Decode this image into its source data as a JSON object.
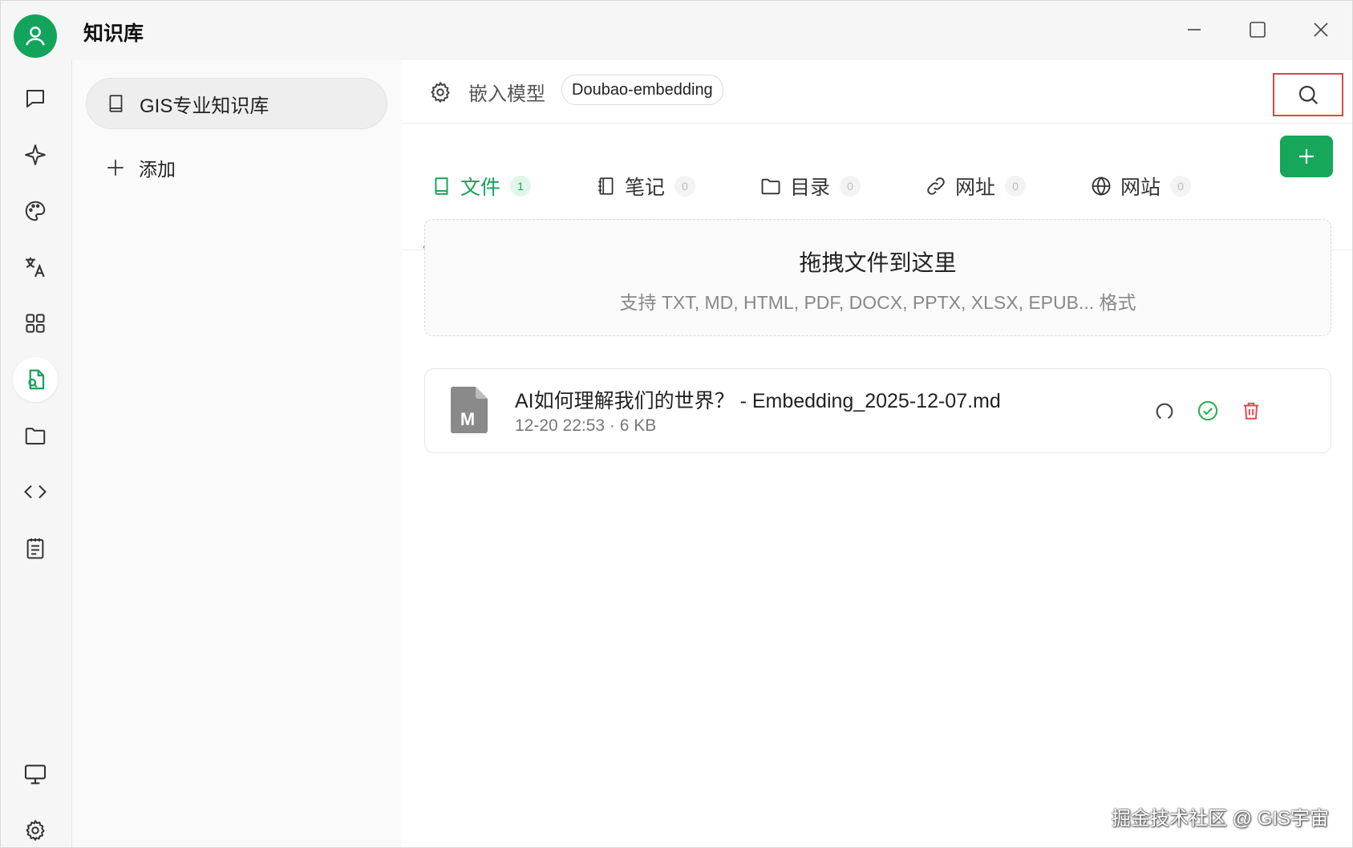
{
  "app": {
    "title": "知识库"
  },
  "colors": {
    "accent": "#17a25a",
    "danger": "#e5484d",
    "highlight_border": "#d9474b"
  },
  "rail": {
    "items": [
      {
        "name": "chat-icon"
      },
      {
        "name": "sparkle-icon"
      },
      {
        "name": "palette-icon"
      },
      {
        "name": "translate-icon"
      },
      {
        "name": "apps-grid-icon"
      },
      {
        "name": "knowledge-base-icon",
        "active": true
      },
      {
        "name": "folder-icon"
      },
      {
        "name": "code-icon"
      },
      {
        "name": "notes-icon"
      }
    ],
    "bottom": [
      {
        "name": "monitor-icon"
      },
      {
        "name": "settings-gear-icon"
      }
    ]
  },
  "kb_list": {
    "items": [
      {
        "label": "GIS专业知识库"
      }
    ],
    "add_label": "添加"
  },
  "main": {
    "embed_model_label": "嵌入模型",
    "embed_model_value": "Doubao-embedding",
    "tabs": [
      {
        "label": "文件",
        "count": "1",
        "icon": "file-icon",
        "active": true
      },
      {
        "label": "笔记",
        "count": "0",
        "icon": "notebook-icon"
      },
      {
        "label": "目录",
        "count": "0",
        "icon": "folder-icon"
      },
      {
        "label": "网址",
        "count": "0",
        "icon": "link-icon"
      },
      {
        "label": "网站",
        "count": "0",
        "icon": "globe-icon"
      }
    ],
    "dropzone": {
      "title": "拖拽文件到这里",
      "subtitle": "支持 TXT, MD, HTML, PDF, DOCX, PPTX, XLSX, EPUB... 格式"
    },
    "files": [
      {
        "name": "AI如何理解我们的世界？ - Embedding_2025-12-07.md",
        "meta": "12-20 22:53 · 6 KB",
        "type_badge": "M"
      }
    ]
  },
  "watermark": "掘金技术社区 @ GIS宇宙"
}
